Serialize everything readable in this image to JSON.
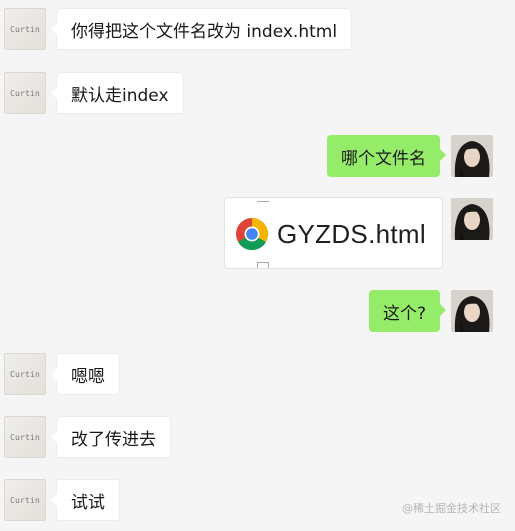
{
  "messages": [
    {
      "sender": "Curtin",
      "text": "你得把这个文件名改为 index.html"
    },
    {
      "sender": "Curtin",
      "text": "默认走index"
    },
    {
      "sender": "me",
      "text": "哪个文件名"
    },
    {
      "sender": "me",
      "type": "file",
      "file_name": "GYZDS.html",
      "icon": "chrome-icon"
    },
    {
      "sender": "me",
      "text": "这个?"
    },
    {
      "sender": "Curtin",
      "text": "嗯嗯"
    },
    {
      "sender": "Curtin",
      "text": "改了传进去"
    },
    {
      "sender": "Curtin",
      "text": "试试"
    }
  ],
  "contact": {
    "avatar_label": "Curtin"
  },
  "watermark": "@稀土掘金技术社区",
  "colors": {
    "background": "#f5f5f5",
    "incoming_bubble": "#ffffff",
    "outgoing_bubble": "#95ec69",
    "text": "#191919"
  }
}
